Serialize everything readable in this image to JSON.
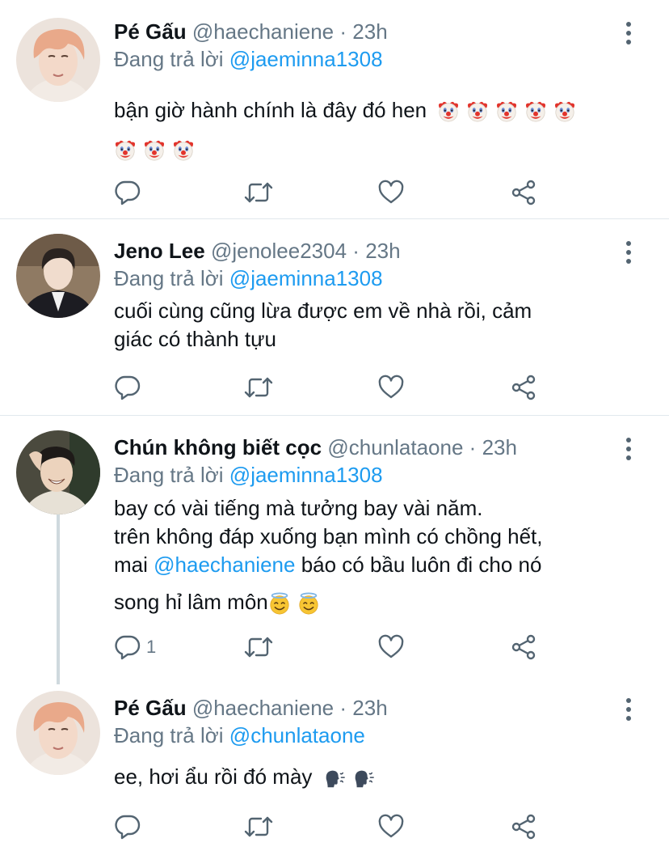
{
  "tweets": [
    {
      "name": "Pé Gấu",
      "handle": "@haechaniene",
      "dot": "·",
      "time": "23h",
      "reply_prefix": "Đang trả lời",
      "reply_to": "@jaeminna1308",
      "body_line1": "bận giờ hành chính là đây đó hen",
      "emoji": "clown-face",
      "reply_count": "",
      "avatar": "peach-haired-man"
    },
    {
      "name": "Jeno Lee",
      "handle": "@jenolee2304",
      "dot": "·",
      "time": "23h",
      "reply_prefix": "Đang trả lời",
      "reply_to": "@jaeminna1308",
      "body_line1": "cuối cùng cũng lừa được em về nhà rồi, cảm",
      "body_line2": "giác có thành tựu",
      "reply_count": "",
      "avatar": "man-in-suit"
    },
    {
      "name": "Chún không biết cọc",
      "handle": "@chunlataone",
      "dot": "·",
      "time": "23h",
      "reply_prefix": "Đang trả lời",
      "reply_to": "@jaeminna1308",
      "body_line1": "bay có vài tiếng mà tưởng bay vài năm.",
      "body_line2": "trên không đáp xuống bạn mình có chồng hết,",
      "body_line3_pre": "mai",
      "body_line3_mention": "@haechaniene",
      "body_line3_post": "báo có bầu luôn đi cho nó",
      "body_line4": "song hỉ lâm môn",
      "emoji": "smiling-face-with-halo",
      "reply_count": "1",
      "avatar": "laughing-man"
    },
    {
      "name": "Pé Gấu",
      "handle": "@haechaniene",
      "dot": "·",
      "time": "23h",
      "reply_prefix": "Đang trả lời",
      "reply_to": "@chunlataone",
      "body_line1": "ee, hơi ẩu rồi đó mày",
      "emoji": "speaking-head",
      "reply_count": "",
      "avatar": "peach-haired-man"
    }
  ],
  "icons": {
    "reply": "reply-icon",
    "retweet": "retweet-icon",
    "like": "like-icon",
    "share": "share-icon",
    "more": "more-icon"
  },
  "colors": {
    "mention": "#1d9bf0",
    "secondary": "#657786",
    "divider": "#e1e8ed"
  }
}
